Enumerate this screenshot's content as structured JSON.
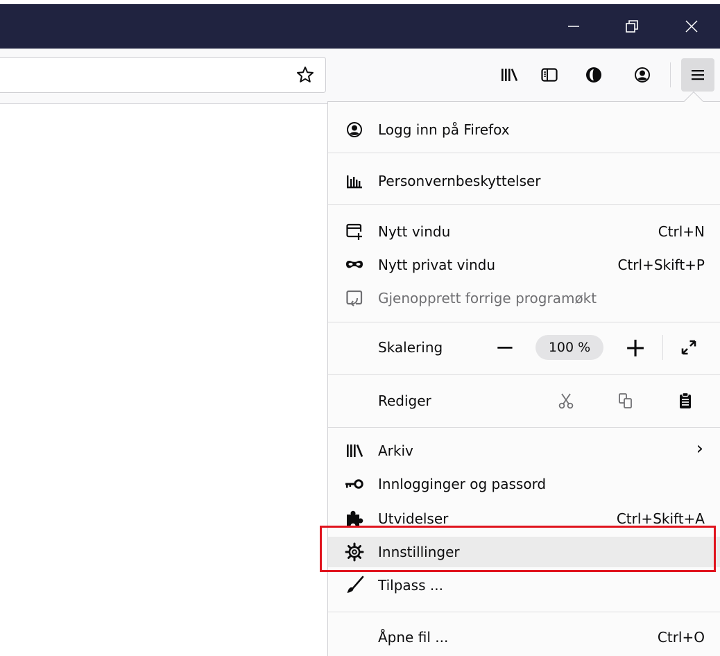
{
  "menu": {
    "account": {
      "label": "Logg inn på Firefox"
    },
    "privacy": {
      "label": "Personvernbeskyttelser"
    },
    "new_window": {
      "label": "Nytt vindu",
      "shortcut": "Ctrl+N"
    },
    "private_window": {
      "label": "Nytt privat vindu",
      "shortcut": "Ctrl+Skift+P"
    },
    "restore_session": {
      "label": "Gjenopprett forrige programøkt"
    },
    "zoom": {
      "label": "Skalering",
      "value": "100 %",
      "minus": "−",
      "plus": "+"
    },
    "edit": {
      "label": "Rediger"
    },
    "library": {
      "label": "Arkiv",
      "chevron": "›"
    },
    "logins": {
      "label": "Innlogginger og passord"
    },
    "addons": {
      "label": "Utvidelser",
      "shortcut": "Ctrl+Skift+A"
    },
    "settings": {
      "label": "Innstillinger"
    },
    "customize": {
      "label": "Tilpass ..."
    },
    "open_file": {
      "label": "Åpne fil ...",
      "shortcut": "Ctrl+O"
    }
  },
  "colors": {
    "titlebar": "#202340",
    "highlight_border": "#e0141e"
  }
}
